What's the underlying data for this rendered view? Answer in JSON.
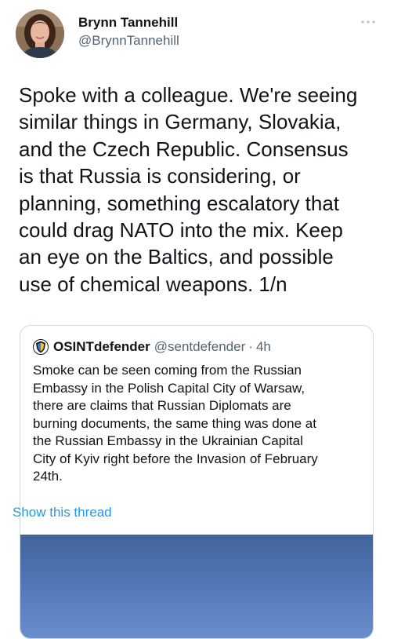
{
  "author": {
    "display_name": "Brynn Tannehill",
    "handle": "@BrynnTannehill"
  },
  "tweet": {
    "text": "Spoke with a colleague. We're seeing\nsimilar things in Germany, Slovakia,\nand the Czech Republic. Consensus\nis that Russia is considering, or\nplanning, something escalatory that\ncould drag NATO into the mix. Keep\nan eye on the Baltics, and possible\nuse of chemical weapons. 1/n"
  },
  "quote": {
    "display_name": "OSINTdefender",
    "handle": "@sentdefender",
    "separator": "·",
    "time": "4h",
    "text": "Smoke can be seen coming from the Russian\nEmbassy in the Polish Capital City of Warsaw,\nthere are claims that Russian Diplomats are\nburning documents, the same thing was done at\nthe Russian Embassy in the Ukrainian Capital\nCity of Kyiv right before the Invasion of February\n24th.",
    "show_thread_label": "Show this thread"
  },
  "icons": {
    "more": "more-horizontal-icon",
    "quote_avatar": "osintdefender-logo"
  },
  "colors": {
    "link": "#1d9bf0",
    "secondary_text": "#536471",
    "border": "#cfd9de",
    "media_sky": "#4d72b0"
  }
}
